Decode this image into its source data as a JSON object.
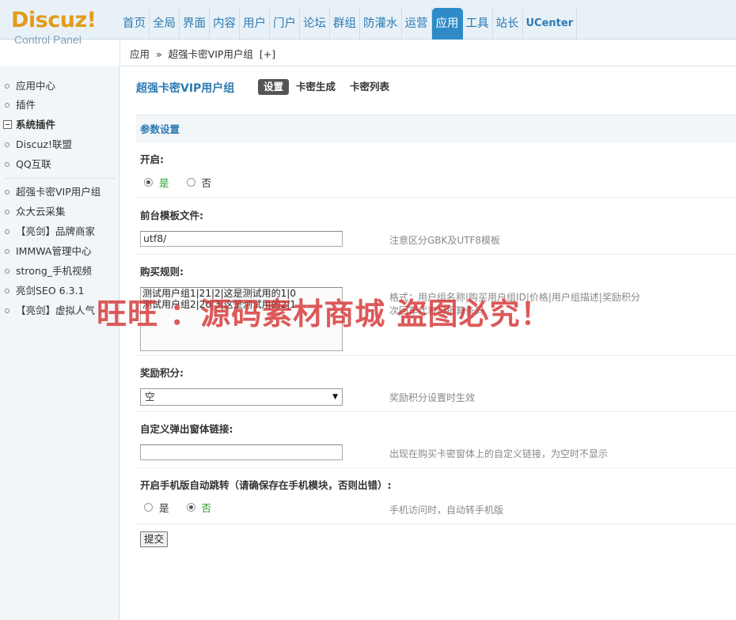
{
  "logo": {
    "main": "Discuz!",
    "sub": "Control Panel"
  },
  "nav": [
    {
      "label": "首页"
    },
    {
      "label": "全局"
    },
    {
      "label": "界面"
    },
    {
      "label": "内容"
    },
    {
      "label": "用户"
    },
    {
      "label": "门户"
    },
    {
      "label": "论坛"
    },
    {
      "label": "群组"
    },
    {
      "label": "防灌水"
    },
    {
      "label": "运营"
    },
    {
      "label": "应用",
      "active": true
    },
    {
      "label": "工具"
    },
    {
      "label": "站长"
    },
    {
      "label": "UCenter"
    }
  ],
  "breadcrumb": {
    "part1": "应用",
    "sep": "»",
    "part2": "超强卡密VIP用户组",
    "add": "[+]"
  },
  "sidebar": {
    "items": [
      {
        "label": "应用中心"
      },
      {
        "label": "插件"
      },
      {
        "label": "系统插件"
      },
      {
        "label": "Discuz!联盟"
      },
      {
        "label": "QQ互联"
      },
      {
        "label": "超强卡密VIP用户组"
      },
      {
        "label": "众大云采集"
      },
      {
        "label": "【亮剑】品牌商家"
      },
      {
        "label": "IMMWA管理中心"
      },
      {
        "label": "strong_手机视频"
      },
      {
        "label": "亮剑SEO 6.3.1"
      },
      {
        "label": "【亮剑】虚拟人气"
      }
    ]
  },
  "main": {
    "plugin_title": "超强卡密VIP用户组",
    "tabs": [
      {
        "label": "设置",
        "active": true
      },
      {
        "label": "卡密生成"
      },
      {
        "label": "卡密列表"
      }
    ],
    "section_title": "参数设置",
    "fields": {
      "enable": {
        "label": "开启:",
        "options": [
          "是",
          "否"
        ],
        "selected": "是"
      },
      "template": {
        "label": "前台模板文件:",
        "value": "utf8/",
        "hint": "注意区分GBK及UTF8模板"
      },
      "rules": {
        "label": "购买规则:",
        "value": "测试用户组1|21|2|这是测试用的1|0\n测试用户组2|20|3|这是测试用的2|1",
        "hint_line1": "格式：用户组名称|购买用户组ID|价格|用户组描述|奖励积分",
        "hint_line2": "  次回车代表可折算条码"
      },
      "reward": {
        "label": "奖励积分:",
        "value": "空",
        "hint": "奖励积分设置时生效"
      },
      "popup_link": {
        "label": "自定义弹出窗体链接:",
        "value": "",
        "hint": "出现在购买卡密窗体上的自定义链接，为空时不显示"
      },
      "mobile_jump": {
        "label": "开启手机版自动跳转（请确保存在手机模块，否则出错）:",
        "options": [
          "是",
          "否"
        ],
        "selected": "否",
        "hint": "手机访问时，自动转手机版"
      }
    },
    "submit_label": "提交"
  },
  "watermark": "旺旺 ：源码素材商城 盗图必究！"
}
